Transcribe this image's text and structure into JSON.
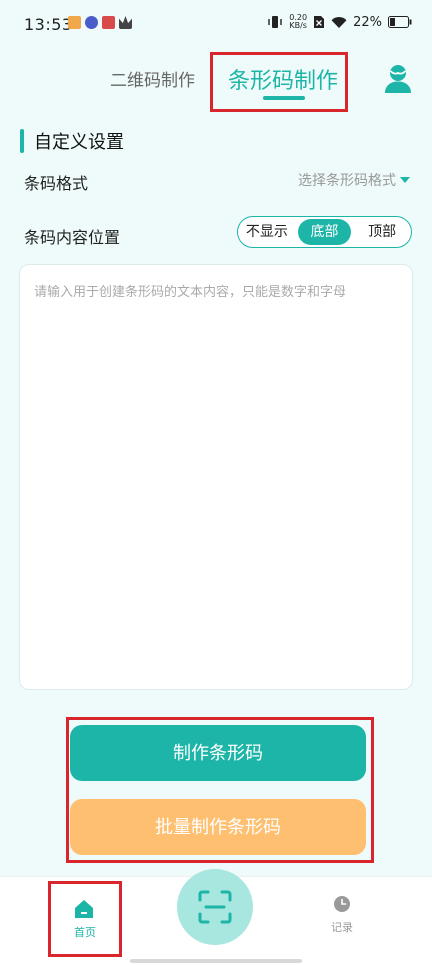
{
  "status_bar": {
    "time": "13:53",
    "net_speed_value": "0.20",
    "net_speed_unit": "KB/s",
    "battery": "22%"
  },
  "header": {
    "tab_qr": "二维码制作",
    "tab_barcode": "条形码制作"
  },
  "settings": {
    "title": "自定义设置",
    "format_label": "条码格式",
    "format_placeholder": "选择条形码格式",
    "position_label": "条码内容位置",
    "position_options": [
      "不显示",
      "底部",
      "顶部"
    ],
    "position_selected": "底部"
  },
  "content_input": {
    "placeholder": "请输入用于创建条形码的文本内容，只能是数字和字母"
  },
  "actions": {
    "make_label": "制作条形码",
    "batch_label": "批量制作条形码"
  },
  "bottom_nav": {
    "home_label": "首页",
    "history_label": "记录"
  },
  "colors": {
    "accent": "#1db5a7",
    "secondary_button": "#ffbf70",
    "highlight_frame": "#d9252c",
    "background": "#eefbfa"
  }
}
